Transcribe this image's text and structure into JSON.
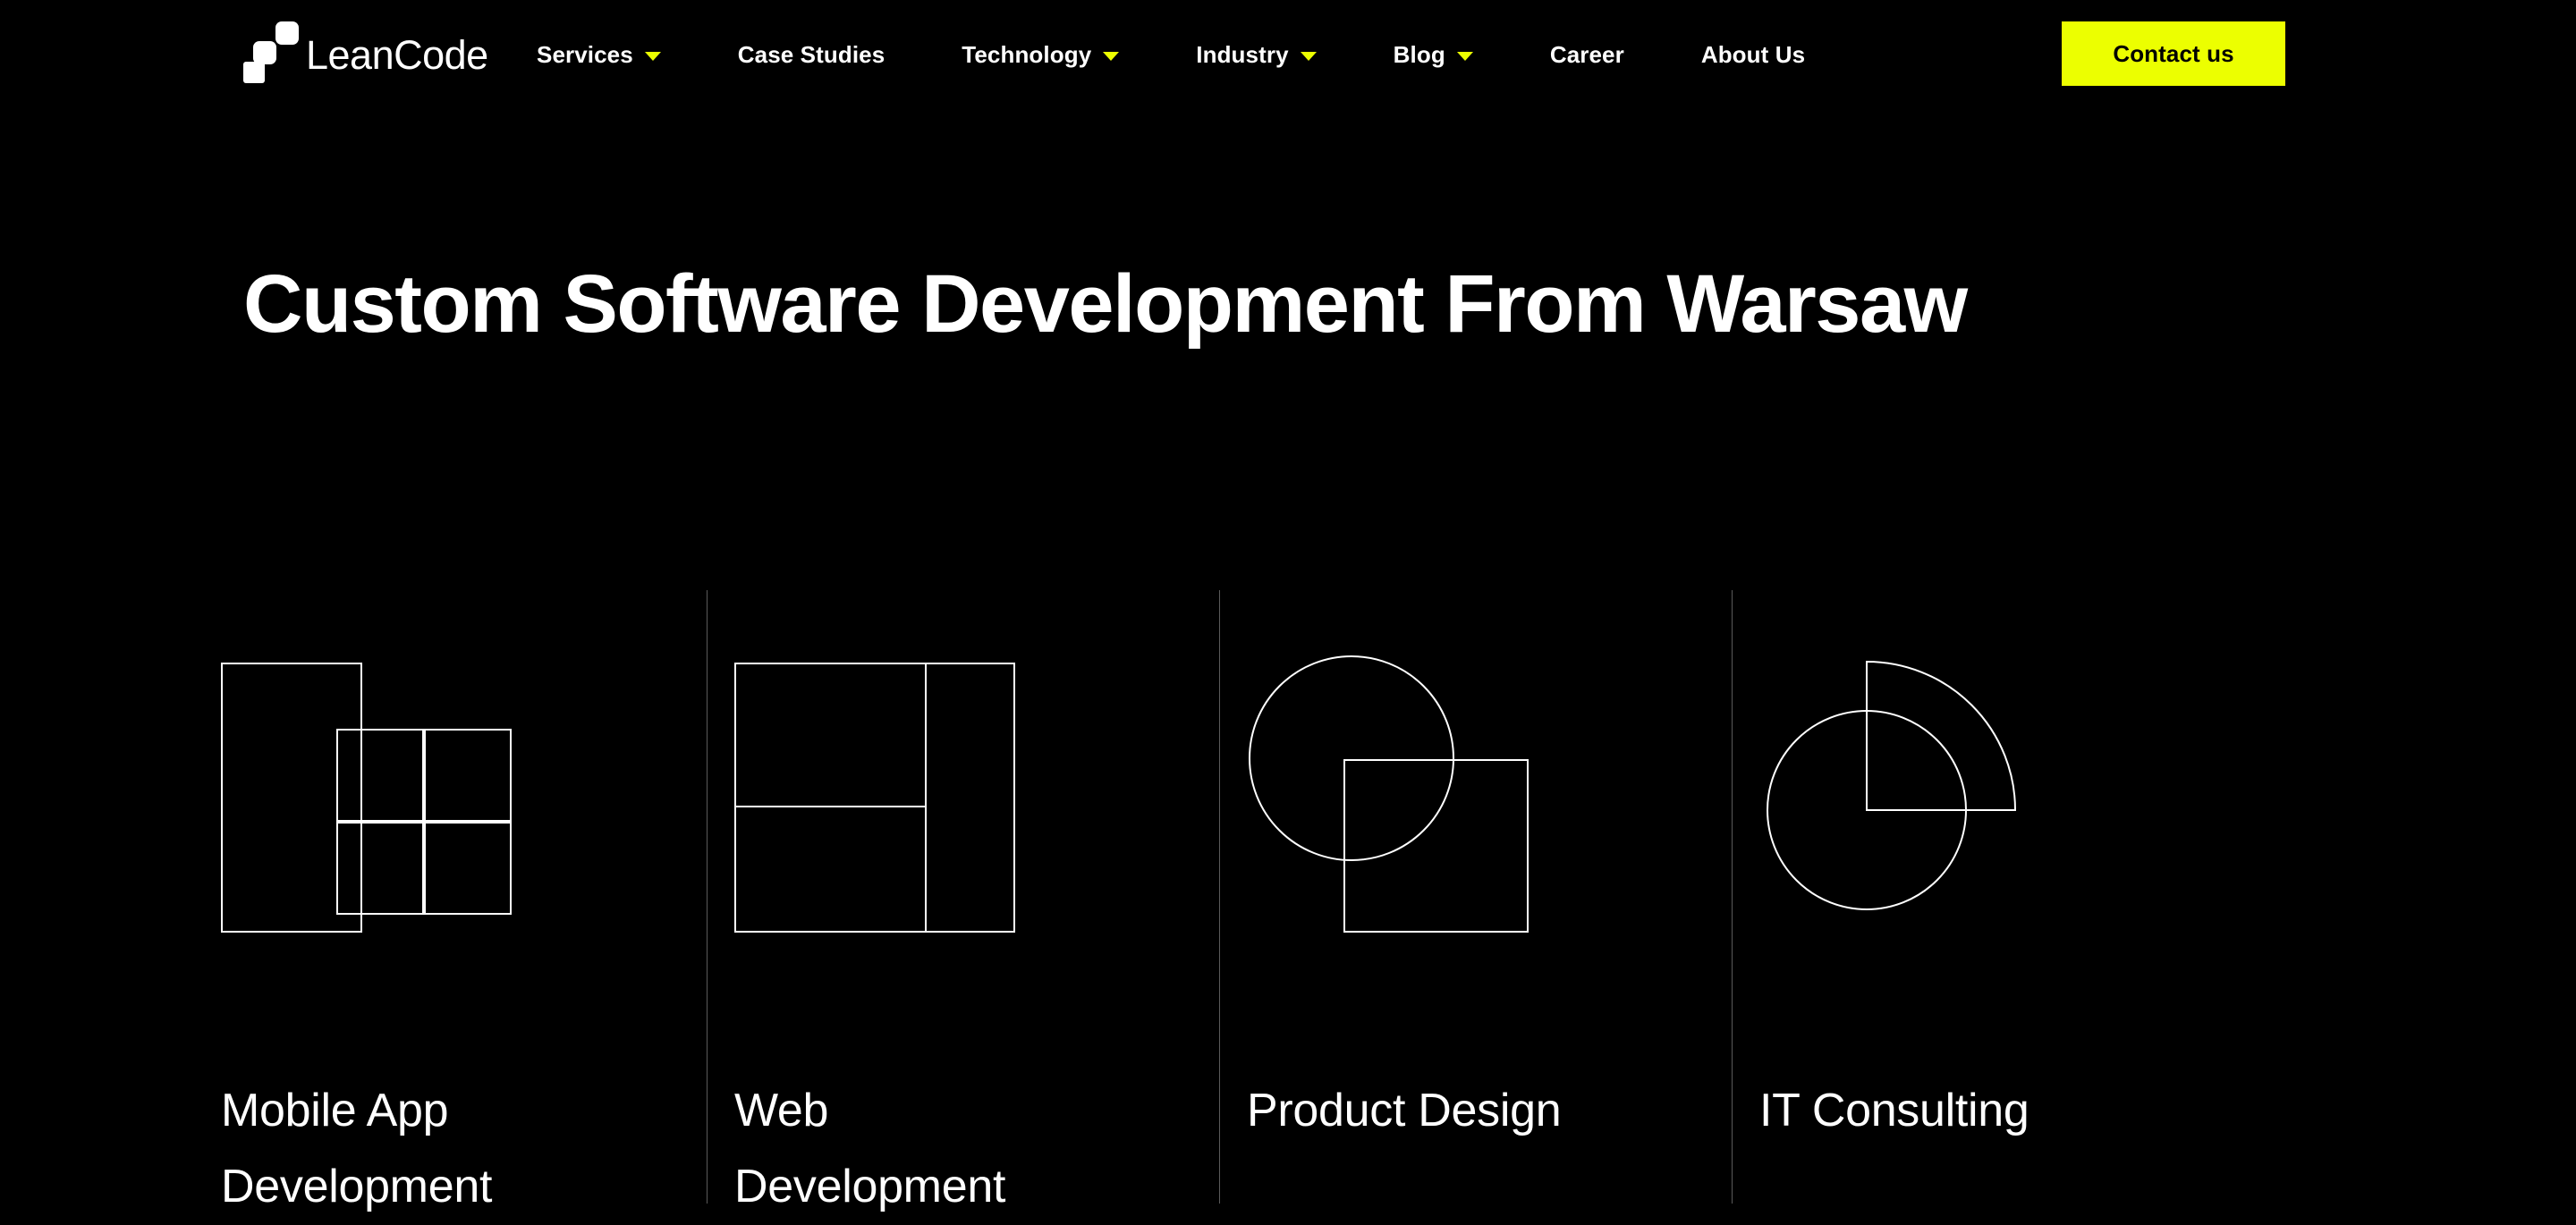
{
  "brand": {
    "name": "LeanCode",
    "logo_icon": "leancode-staircase-logo"
  },
  "nav": {
    "items": [
      {
        "label": "Services",
        "has_dropdown": true,
        "icon": "chevron-down-icon"
      },
      {
        "label": "Case Studies",
        "has_dropdown": false,
        "icon": ""
      },
      {
        "label": "Technology",
        "has_dropdown": true,
        "icon": "chevron-down-icon"
      },
      {
        "label": "Industry",
        "has_dropdown": true,
        "icon": "chevron-down-icon"
      },
      {
        "label": "Blog",
        "has_dropdown": true,
        "icon": "chevron-down-icon"
      },
      {
        "label": "Career",
        "has_dropdown": false,
        "icon": ""
      },
      {
        "label": "About Us",
        "has_dropdown": false,
        "icon": ""
      }
    ],
    "cta_label": "Contact us"
  },
  "hero": {
    "title": "Custom Software Development From Warsaw"
  },
  "services": {
    "cards": [
      {
        "label": "Mobile App Development",
        "icon": "mobile-app-development-icon"
      },
      {
        "label": "Web Development",
        "icon": "web-development-icon"
      },
      {
        "label": "Product Design",
        "icon": "product-design-icon"
      },
      {
        "label": "IT Consulting",
        "icon": "it-consulting-icon"
      }
    ]
  },
  "colors": {
    "background": "#000000",
    "accent_yellow": "#ecff00",
    "text_primary": "#ffffff",
    "divider": "#5a5a5a",
    "icon_stroke": "#ffffff"
  }
}
